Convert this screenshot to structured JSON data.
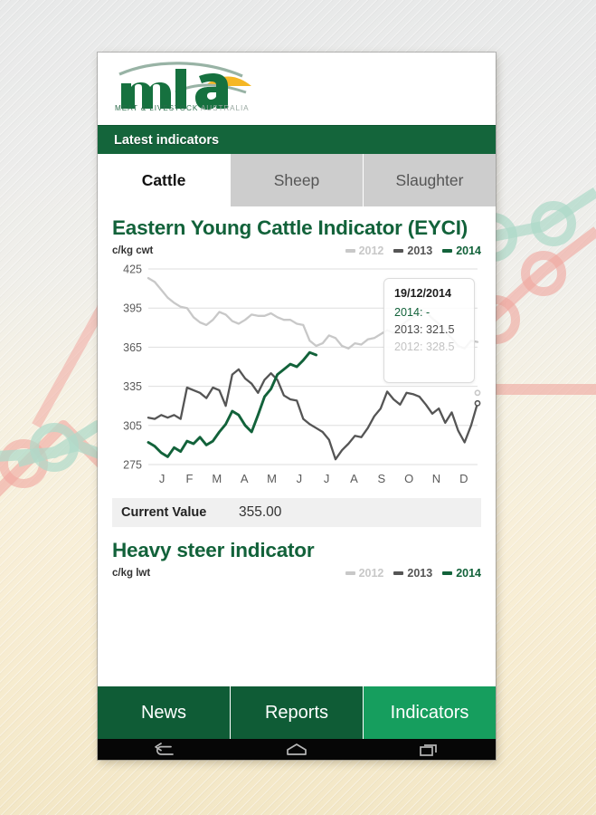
{
  "app": {
    "logo": {
      "wordmark": "mla",
      "tagline_bold": "MEAT & LIVESTOCK ",
      "tagline_dim": "AUSTRALIA"
    },
    "title_bar": "Latest indicators"
  },
  "tabs": [
    {
      "label": "Cattle",
      "active": true
    },
    {
      "label": "Sheep",
      "active": false
    },
    {
      "label": "Slaughter",
      "active": false
    }
  ],
  "eyci": {
    "title": "Eastern Young Cattle Indicator (EYCI)",
    "unit": "c/kg cwt",
    "current_value_label": "Current Value",
    "current_value": "355.00",
    "tooltip": {
      "date": "19/12/2014",
      "rows": [
        {
          "label": "2014: -",
          "series": "2014"
        },
        {
          "label": "2013: 321.5",
          "series": "2013"
        },
        {
          "label": "2012: 328.5",
          "series": "2012"
        }
      ]
    }
  },
  "heavy_steer": {
    "title": "Heavy steer indicator",
    "unit": "c/kg lwt"
  },
  "legend": [
    {
      "label": "2012",
      "color": "#c8c8c8"
    },
    {
      "label": "2013",
      "color": "#555555"
    },
    {
      "label": "2014",
      "color": "#12623a"
    }
  ],
  "bottom_nav": [
    {
      "label": "News",
      "active": false
    },
    {
      "label": "Reports",
      "active": false
    },
    {
      "label": "Indicators",
      "active": true
    }
  ],
  "system_bar": {
    "back": "back-icon",
    "home": "home-icon",
    "recents": "recents-icon"
  },
  "chart_data": {
    "type": "line",
    "title": "Eastern Young Cattle Indicator (EYCI)",
    "ylabel": "c/kg cwt",
    "xlabel": "",
    "ylim": [
      275,
      425
    ],
    "yticks": [
      275,
      305,
      335,
      365,
      395,
      425
    ],
    "grid": true,
    "legend_position": "top-right",
    "categories": [
      "J",
      "F",
      "M",
      "A",
      "M",
      "J",
      "J",
      "A",
      "S",
      "O",
      "N",
      "D"
    ],
    "x": [
      0,
      1,
      2,
      3,
      4,
      5,
      6,
      7,
      8,
      9,
      10,
      11,
      12,
      13,
      14,
      15,
      16,
      17,
      18,
      19,
      20,
      21,
      22,
      23,
      24,
      25,
      26,
      27,
      28,
      29,
      30,
      31,
      32,
      33,
      34,
      35,
      36,
      37,
      38,
      39,
      40,
      41,
      42,
      43,
      44,
      45,
      46,
      47,
      48,
      49,
      50,
      51
    ],
    "series": [
      {
        "name": "2012",
        "color": "#c8c8c8",
        "values": [
          418,
          415,
          409,
          403,
          399,
          396,
          395,
          388,
          384,
          382,
          386,
          392,
          390,
          385,
          383,
          386,
          390,
          389,
          389,
          391,
          388,
          386,
          386,
          383,
          382,
          370,
          366,
          368,
          374,
          372,
          366,
          364,
          368,
          367,
          371,
          372,
          375,
          378,
          376,
          381,
          385,
          388,
          391,
          392,
          387,
          383,
          377,
          372,
          366,
          364,
          370,
          369
        ]
      },
      {
        "name": "2013",
        "color": "#555555",
        "values": [
          311,
          310,
          313,
          311,
          313,
          310,
          334,
          332,
          330,
          326,
          334,
          332,
          320,
          344,
          348,
          341,
          337,
          330,
          340,
          345,
          340,
          328,
          325,
          324,
          310,
          306,
          303,
          300,
          294,
          279,
          286,
          291,
          297,
          296,
          303,
          312,
          318,
          331,
          325,
          321,
          330,
          329,
          327,
          321,
          314,
          318,
          307,
          315,
          301,
          292,
          305,
          322
        ]
      },
      {
        "name": "2014",
        "color": "#12623a",
        "values": [
          292,
          289,
          284,
          281,
          288,
          285,
          293,
          291,
          296,
          290,
          293,
          300,
          306,
          316,
          313,
          305,
          300,
          313,
          327,
          333,
          344,
          348,
          352,
          350,
          355,
          361,
          359,
          null,
          null,
          null,
          null,
          null,
          null,
          null,
          null,
          null,
          null,
          null,
          null,
          null,
          null,
          null,
          null,
          null,
          null,
          null,
          null,
          null,
          null,
          null,
          null,
          null
        ]
      }
    ],
    "endpoint_markers": [
      {
        "series": "2012",
        "x": 51,
        "y": 330
      },
      {
        "series": "2013",
        "x": 51,
        "y": 322
      }
    ]
  }
}
